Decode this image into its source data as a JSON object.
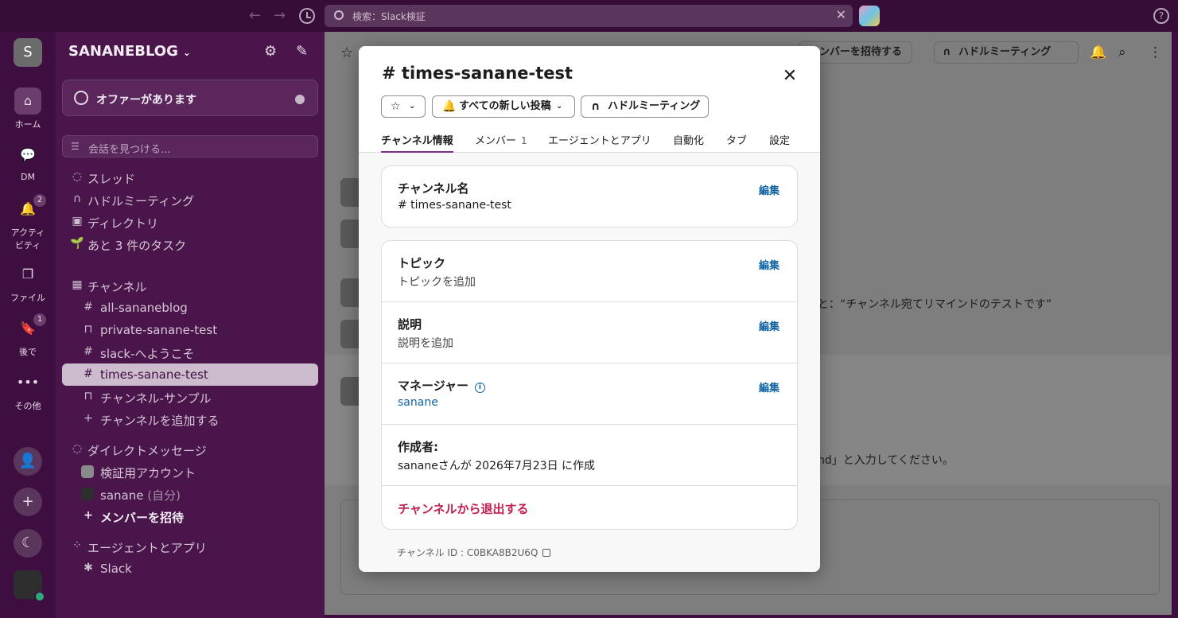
{
  "topbar": {
    "search_placeholder": "検索：Slack検証"
  },
  "rail": {
    "workspace_initial": "S",
    "items": [
      {
        "label": "ホーム"
      },
      {
        "label": "DM"
      },
      {
        "label": "アクティビティ",
        "label_line1": "アクティ",
        "label_line2": "ビティ",
        "badge": "2"
      },
      {
        "label": "ファイル"
      },
      {
        "label": "後で",
        "badge": "1"
      },
      {
        "label": "その他"
      }
    ]
  },
  "sidebar": {
    "workspace_name": "SANANEBLOG",
    "offer_label": "オファーがあります",
    "find_placeholder": "会話を見つける...",
    "nav": [
      {
        "label": "スレッド"
      },
      {
        "label": "ハドルミーティング"
      },
      {
        "label": "ディレクトリ"
      },
      {
        "label": "あと 3 件のタスク"
      }
    ],
    "channels_header": "チャンネル",
    "channels": [
      {
        "prefix": "#",
        "label": "all-sananeblog"
      },
      {
        "prefix": "🔒",
        "label": "private-sanane-test"
      },
      {
        "prefix": "#",
        "label": "slack-へようこそ"
      },
      {
        "prefix": "#",
        "label": "times-sanane-test"
      },
      {
        "prefix": "🔒",
        "label": "チャンネル-サンプル"
      },
      {
        "prefix": "+",
        "label": "チャンネルを追加する"
      }
    ],
    "dm_header": "ダイレクトメッセージ",
    "dms": [
      {
        "label": "検証用アカウント"
      },
      {
        "label": "sanane",
        "suffix": "(自分)"
      }
    ],
    "invite_label": "メンバーを招待",
    "apps_header": "エージェントとアプリ",
    "apps": [
      {
        "label": "Slack"
      }
    ]
  },
  "main": {
    "invite_button": "メンバーを招待する",
    "huddle_button": "ハドルミーティング",
    "bg_message_1": "と：“チャンネル宛てリマインドのテストです”",
    "bg_message_2": "nd」と入力してください。"
  },
  "modal": {
    "title": "times-sanane-test",
    "notify_label": "すべての新しい投稿",
    "huddle_label": "ハドルミーティング",
    "tabs": [
      {
        "label": "チャンネル情報"
      },
      {
        "label": "メンバー",
        "count": "1"
      },
      {
        "label": "エージェントとアプリ"
      },
      {
        "label": "自動化"
      },
      {
        "label": "タブ"
      },
      {
        "label": "設定"
      }
    ],
    "channel_name_label": "チャンネル名",
    "channel_name_value": "# times-sanane-test",
    "edit_label": "編集",
    "topic_label": "トピック",
    "topic_value": "トピックを追加",
    "description_label": "説明",
    "description_value": "説明を追加",
    "manager_label": "マネージャー",
    "manager_value": "sanane",
    "creator_label": "作成者:",
    "creator_value": "sananeさんが 2026年7月23日 に作成",
    "leave_label": "チャンネルから退出する",
    "channel_id": "チャンネル ID : C0BKA8B2U6Q"
  }
}
